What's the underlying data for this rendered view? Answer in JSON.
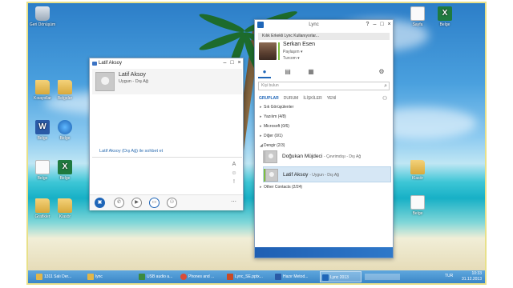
{
  "desktop": {
    "icons": [
      {
        "label": "Geri Dönüşüm",
        "kind": "recycle"
      },
      {
        "label": "Kısayollar",
        "kind": "folder"
      },
      {
        "label": "Belgeler",
        "kind": "folder"
      },
      {
        "label": "Belge",
        "kind": "word"
      },
      {
        "label": "Belge",
        "kind": "blue"
      },
      {
        "label": "Belge",
        "kind": "doc"
      },
      {
        "label": "Belge",
        "kind": "excel"
      },
      {
        "label": "Grafikler",
        "kind": "folder"
      },
      {
        "label": "Klasör",
        "kind": "folder"
      },
      {
        "label": "Sayfa",
        "kind": "doc"
      },
      {
        "label": "Belge",
        "kind": "excel"
      },
      {
        "label": "Belge",
        "kind": "doc"
      },
      {
        "label": "Klasör",
        "kind": "folder"
      }
    ]
  },
  "chat_window": {
    "title": "Latif Aksoy",
    "contact_name": "Latif Aksoy",
    "contact_status": "Uygun - Dış Ağ",
    "conversation_link": "Latif Aksoy (Dış Ağ) ile sohbet et",
    "side_tools": [
      "A",
      "☺",
      "!"
    ],
    "toolbar": [
      "IM",
      "Telefon",
      "Video",
      "Paylaş",
      "Kişiler",
      "Diğer"
    ],
    "window_buttons": [
      "–",
      "□",
      "×"
    ]
  },
  "lync_window": {
    "title": "Lync",
    "note_placeholder": "Kılık Erkekli Lync Kullanıyorlar...",
    "user": {
      "name": "Serkan Esen",
      "sharing": "Paylaşım ▾",
      "location": "Turcom ▾"
    },
    "search_placeholder": "Kişi bulun",
    "filter_tabs": [
      "GRUPLAR",
      "DURUM",
      "İLİŞKİLER",
      "YENİ"
    ],
    "groups": [
      {
        "label": "Sık Görüşülenler",
        "expanded": false
      },
      {
        "label": "Yazılım (4/8)",
        "expanded": false
      },
      {
        "label": "Microsoft (0/6)",
        "expanded": false
      },
      {
        "label": "Diğer (0/1)",
        "expanded": false
      },
      {
        "label": "Dengir (2/3)",
        "expanded": true
      },
      {
        "label": "Other Contacts (2/24)",
        "expanded": false
      }
    ],
    "contacts": [
      {
        "name": "Doğukan Müjdeci",
        "status": "- Çevrimdışı - Dış Ağ",
        "presence": "#bfbfbf"
      },
      {
        "name": "Latif Aksoy",
        "status": "- Uygun - Dış Ağ",
        "presence": "#7fbf3f"
      }
    ],
    "window_buttons": [
      "?",
      "–",
      "□",
      "×"
    ]
  },
  "taskbar": {
    "items": [
      {
        "label": "1311 Salı Der...",
        "color": "#e0b64a"
      },
      {
        "label": "lync",
        "color": "#e0b64a"
      },
      {
        "label": "USB audio a...",
        "color": "#3b8a3e"
      },
      {
        "label": "Phones and ...",
        "color": "#d94c38"
      },
      {
        "label": "Lync_SE.pptx...",
        "color": "#c84a26"
      },
      {
        "label": "Hazır Metod...",
        "color": "#2a5aa6"
      },
      {
        "label": "Lync 2013",
        "color": "#1f66b8"
      }
    ],
    "tray_time": "10:33",
    "tray_date": "31.12.2013",
    "tray_lang": "TUR"
  }
}
